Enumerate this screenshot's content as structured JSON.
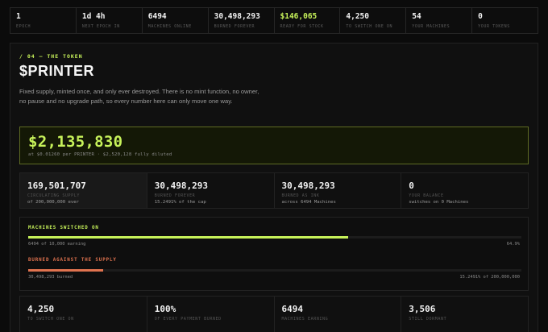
{
  "topbar": [
    {
      "value": "1",
      "label": "EPOCH",
      "accent": false
    },
    {
      "value": "1d 4h",
      "label": "NEXT EPOCH IN",
      "accent": false
    },
    {
      "value": "6494",
      "label": "MACHINES ONLINE",
      "accent": false
    },
    {
      "value": "30,498,293",
      "label": "BURNED FOREVER",
      "accent": false
    },
    {
      "value": "$146,065",
      "label": "READY FOR STOCK",
      "accent": true
    },
    {
      "value": "4,250",
      "label": "TO SWITCH ONE ON",
      "accent": false
    },
    {
      "value": "54",
      "label": "YOUR MACHINES",
      "accent": false
    },
    {
      "value": "0",
      "label": "YOUR TOKENS",
      "accent": false
    }
  ],
  "section": {
    "kicker": "/ 04 — THE TOKEN",
    "title": "$PRINTER",
    "description": "Fixed supply, minted once, and only ever destroyed. There is no mint function, no owner, no pause and no upgrade path, so every number here can only move one way."
  },
  "price": {
    "market_cap": "$2,135,830",
    "subline": "at $0.01260 per PRINTER · $2,520,128 fully diluted"
  },
  "supply_stats": [
    {
      "value": "169,501,707",
      "label": "CIRCULATING SUPPLY",
      "sub": "of 200,000,000 ever"
    },
    {
      "value": "30,498,293",
      "label": "BURNED FOREVER",
      "sub": "15.2491% of the cap"
    },
    {
      "value": "30,498,293",
      "label": "BURNED AS INK",
      "sub": "across 6494 Machines"
    },
    {
      "value": "0",
      "label": "YOUR BALANCE",
      "sub": "switches on 0 Machines"
    }
  ],
  "progress": {
    "machines": {
      "label": "MACHINES SWITCHED ON",
      "left_caption": "6494 of 10,000 earning",
      "right_caption": "64.9%",
      "fraction": 0.649,
      "color": "#c7f25a"
    },
    "burn": {
      "label": "BURNED AGAINST THE SUPPLY",
      "left_caption": "30,498,293 burned",
      "right_caption": "15.2491% of 200,000,000",
      "fraction": 0.152491,
      "color": "#e0734f"
    }
  },
  "bottom_stats": [
    {
      "value": "4,250",
      "label": "TO SWITCH ONE ON"
    },
    {
      "value": "100%",
      "label": "OF EVERY PAYMENT BURNED"
    },
    {
      "value": "6494",
      "label": "MACHINES EARNING"
    },
    {
      "value": "3,506",
      "label": "STILL DORMANT"
    }
  ],
  "colors": {
    "accent": "#c7f25a",
    "burn": "#e0734f",
    "background": "#0b0b0b"
  }
}
